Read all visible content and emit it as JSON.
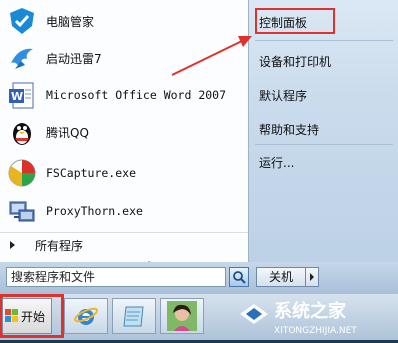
{
  "programs": [
    {
      "label": "电脑管家",
      "icon": "tencent-pc-manager-icon"
    },
    {
      "label": "启动迅雷7",
      "icon": "xunlei-bird-icon"
    },
    {
      "label": "Microsoft Office Word 2007",
      "icon": "word-icon"
    },
    {
      "label": "腾讯QQ",
      "icon": "qq-penguin-icon"
    },
    {
      "label": "FSCapture.exe",
      "icon": "fscapture-icon"
    },
    {
      "label": "ProxyThorn.exe",
      "icon": "proxythorn-icon"
    }
  ],
  "all_programs": "所有程序",
  "right": {
    "control_panel": "控制面板",
    "devices": "设备和打印机",
    "defaults": "默认程序",
    "help": "帮助和支持",
    "run": "运行..."
  },
  "search": {
    "placeholder": "搜索程序和文件"
  },
  "shutdown": "关机",
  "start": "开始",
  "watermark": {
    "name": "系统之家",
    "url": "XITONGZHIJIA.NET"
  },
  "colors": {
    "highlight": "#e0312c"
  }
}
